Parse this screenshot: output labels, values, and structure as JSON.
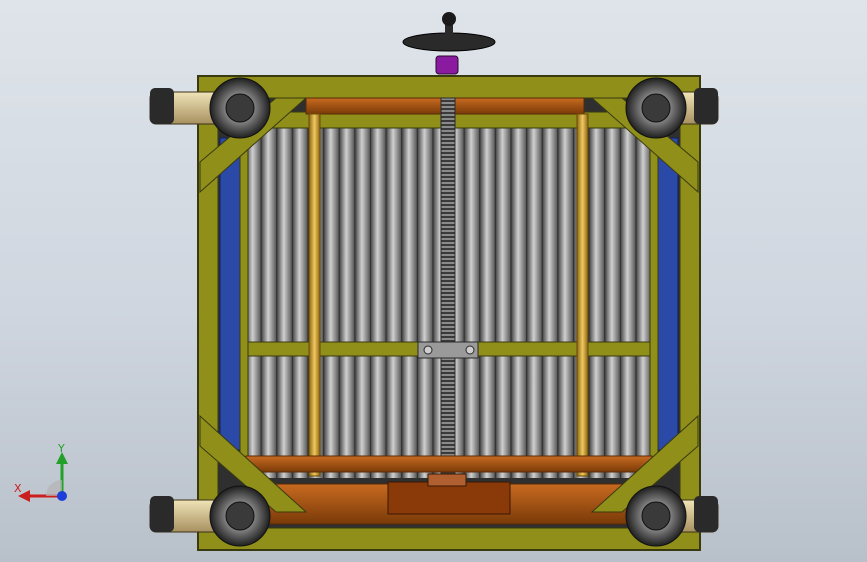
{
  "viewport": {
    "background_top": "#dfe4ea",
    "background_bottom": "#b8c0ca"
  },
  "model": {
    "frame_color": "#8f8f1a",
    "frame_edge_color": "#3a3a10",
    "screw_color": "#9a9a9a",
    "fin_light": "#c8c8c8",
    "fin_dark": "#5c5c5c",
    "rod_color": "#d2a02a",
    "plate_color": "#b35a10",
    "side_panel_color": "#2b4aa8",
    "handwheel_color": "#2a2a2a",
    "handwheel_hub_color": "#8a1aa0",
    "caster_tire_color": "#d8c89a"
  },
  "triad": {
    "x_label": "X",
    "y_label": "Y",
    "x_color": "#cc1e1e",
    "y_color": "#22a02a",
    "origin_color": "#1d3ed8"
  }
}
